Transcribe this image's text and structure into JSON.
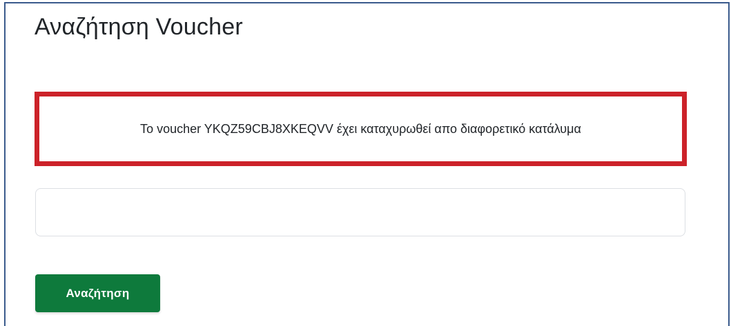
{
  "page": {
    "title": "Αναζήτηση Voucher"
  },
  "alert": {
    "message": "Το voucher YKQZ59CBJ8XKEQVV έχει καταχυρωθεί απο διαφορετικό κατάλυμα",
    "border_color": "#cc2229"
  },
  "search": {
    "value": "",
    "placeholder": ""
  },
  "actions": {
    "search_label": "Αναζήτηση",
    "button_color": "#0e7a3c"
  }
}
